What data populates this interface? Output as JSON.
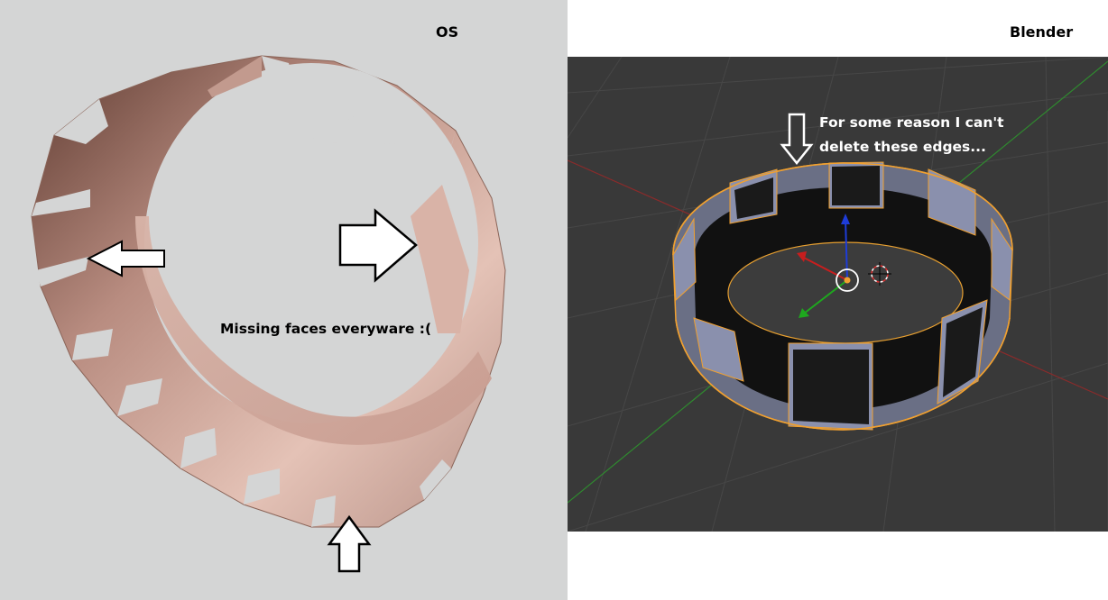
{
  "left_panel": {
    "title": "OS",
    "annotation": "Missing faces everyware :(",
    "model_color": "#d8aea2",
    "background_color": "#d4d5d5"
  },
  "right_panel": {
    "title": "Blender",
    "annotation": "For some reason I can't delete these edges...",
    "viewport_color": "#393939",
    "selection_color": "#f0a030",
    "model_color": "#7a82a0"
  },
  "icons": {
    "left_arrow": "arrow-left-outline",
    "right_arrow": "arrow-right-outline",
    "up_arrow": "arrow-up-outline",
    "down_arrow": "arrow-down-outline"
  }
}
